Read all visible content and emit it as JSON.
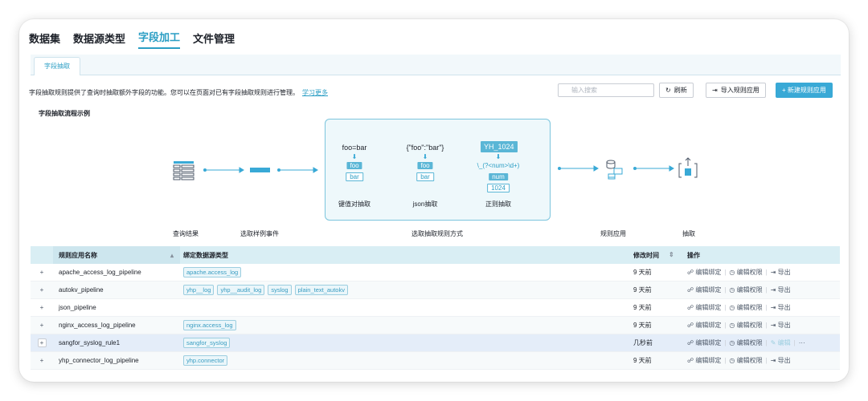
{
  "nav": {
    "items": [
      "数据集",
      "数据源类型",
      "字段加工",
      "文件管理"
    ],
    "active": 2
  },
  "subtab": "字段抽取",
  "description": "字段抽取规则提供了查询时抽取额外字段的功能。您可以在页面对已有字段抽取规则进行管理。",
  "learn_more": "学习更多",
  "search": {
    "placeholder": "输入搜索"
  },
  "toolbar": {
    "refresh": "刷新",
    "import": "导入规则应用",
    "new": "+ 新建规则应用"
  },
  "flow": {
    "title": "字段抽取流程示例",
    "steps": {
      "query_result": "查询结果",
      "select_sample": "选取样例事件",
      "select_method": "选取抽取规则方式",
      "rule_apply": "规则应用",
      "extract": "抽取"
    },
    "kv": {
      "expr": "foo=bar",
      "key": "foo",
      "val": "bar",
      "label": "键值对抽取"
    },
    "json": {
      "expr": "{\"foo\":\"bar\"}",
      "key": "foo",
      "val": "bar",
      "label": "json抽取"
    },
    "regex": {
      "sample": "YH_1024",
      "pattern": "\\_(?<num>\\d+)",
      "key": "num",
      "val": "1024",
      "label": "正则抽取"
    }
  },
  "table": {
    "headers": {
      "name": "规则应用名称",
      "types": "绑定数据源类型",
      "modified": "修改时间",
      "actions": "操作"
    },
    "actions": {
      "edit_bind": "编辑绑定",
      "edit_perm": "编辑权限",
      "export": "导出",
      "edit": "编辑",
      "more": "···"
    },
    "rows": [
      {
        "name": "apache_access_log_pipeline",
        "types": [
          "apache.access_log"
        ],
        "modified": "9 天前"
      },
      {
        "name": "autokv_pipeline",
        "types": [
          "yhp__log",
          "yhp__audit_log",
          "syslog",
          "plain_text_autokv"
        ],
        "modified": "9 天前"
      },
      {
        "name": "json_pipeline",
        "types": [],
        "modified": "9 天前"
      },
      {
        "name": "nginx_access_log_pipeline",
        "types": [
          "nginx.access_log"
        ],
        "modified": "9 天前"
      },
      {
        "name": "sangfor_syslog_rule1",
        "types": [
          "sangfor_syslog"
        ],
        "modified": "几秒前"
      },
      {
        "name": "yhp_connector_log_pipeline",
        "types": [
          "yhp.connector"
        ],
        "modified": "9 天前"
      }
    ]
  },
  "colors": {
    "accent": "#2b9ec4",
    "primary_button": "#39a9d6",
    "header_bg": "#d9eef4",
    "selected_row": "#e4edf9"
  }
}
